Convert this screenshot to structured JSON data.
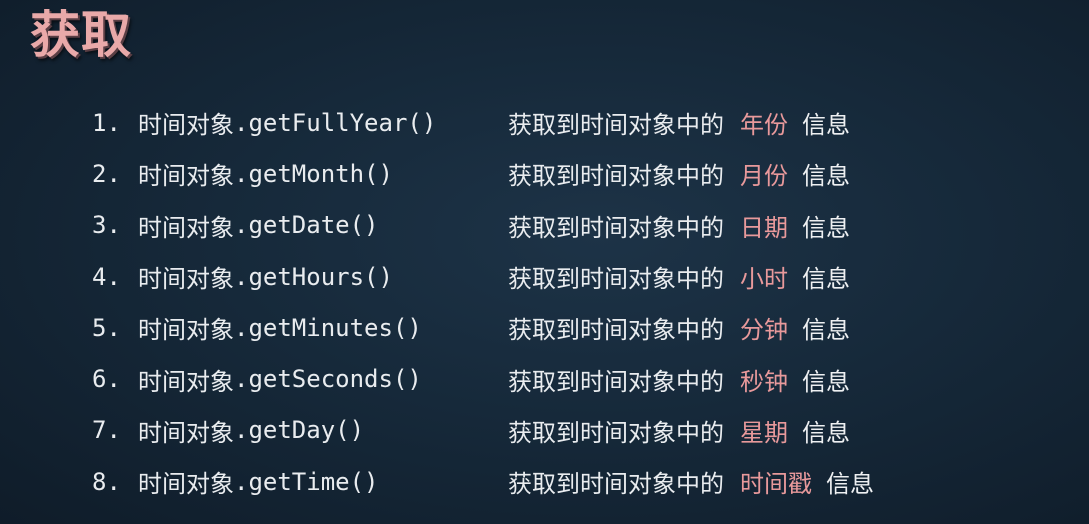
{
  "title": "获取",
  "colors": {
    "background": "#16293a",
    "text": "#e9ecef",
    "highlight": "#e8999b",
    "title": "#e9a9a9"
  },
  "methods": [
    {
      "num": "1.",
      "object": "时间对象",
      "method": ".getFullYear()",
      "prefix": "获取到时间对象中的",
      "highlight": "年份",
      "suffix": "信息"
    },
    {
      "num": "2.",
      "object": "时间对象",
      "method": ".getMonth()",
      "prefix": "获取到时间对象中的",
      "highlight": "月份",
      "suffix": "信息"
    },
    {
      "num": "3.",
      "object": "时间对象",
      "method": ".getDate()",
      "prefix": "获取到时间对象中的",
      "highlight": "日期",
      "suffix": "信息"
    },
    {
      "num": "4.",
      "object": "时间对象",
      "method": ".getHours()",
      "prefix": "获取到时间对象中的",
      "highlight": "小时",
      "suffix": "信息"
    },
    {
      "num": "5.",
      "object": "时间对象",
      "method": ".getMinutes()",
      "prefix": "获取到时间对象中的",
      "highlight": "分钟",
      "suffix": "信息"
    },
    {
      "num": "6.",
      "object": "时间对象",
      "method": ".getSeconds()",
      "prefix": "获取到时间对象中的",
      "highlight": "秒钟",
      "suffix": "信息"
    },
    {
      "num": "7.",
      "object": "时间对象",
      "method": ".getDay()",
      "prefix": "获取到时间对象中的",
      "highlight": "星期",
      "suffix": "信息"
    },
    {
      "num": "8.",
      "object": "时间对象",
      "method": ".getTime()",
      "prefix": "获取到时间对象中的",
      "highlight": "时间戳",
      "suffix": "信息"
    }
  ]
}
